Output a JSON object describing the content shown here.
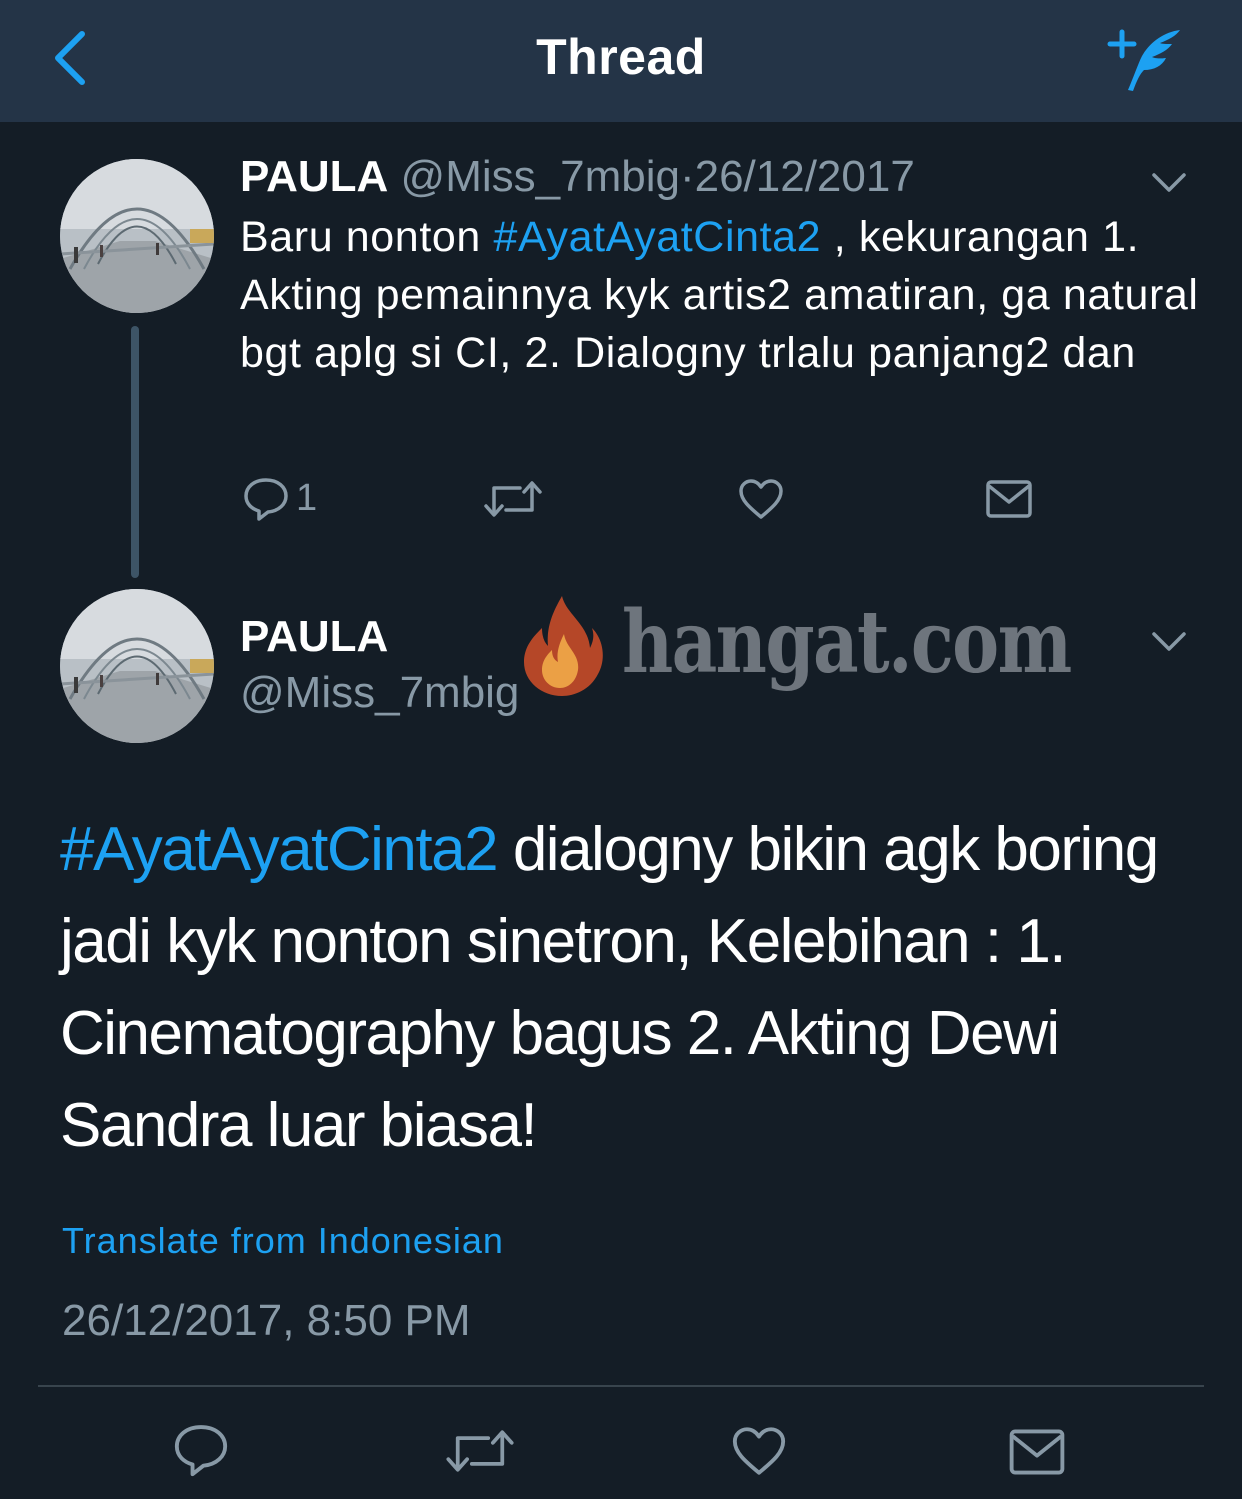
{
  "navbar": {
    "title": "Thread",
    "back_icon": "chevron-left-icon",
    "compose_icon": "compose-tweet-icon"
  },
  "tweet1": {
    "name": "PAULA",
    "handle": "@Miss_7mbig",
    "separator": "·",
    "date": "26/12/2017",
    "text_before": "Baru nonton ",
    "hashtag": "#AyatAyatCinta2",
    "text_after": " , kekurangan 1. Akting pemainnya kyk artis2 amatiran, ga natural bgt aplg si CI, 2. Dialogny trlalu panjang2 dan",
    "reply_count": "1"
  },
  "tweet2": {
    "name": "PAULA",
    "handle": "@Miss_7mbig",
    "hashtag": "#AyatAyatCinta2",
    "text_after": " dialogny bikin agk boring jadi kyk nonton sinetron, Kelebihan : 1. Cinematography bagus 2. Akting Dewi Sandra luar biasa!",
    "translate_label": "Translate from Indonesian",
    "timestamp": "26/12/2017, 8:50 PM"
  },
  "watermark": {
    "text": "hangat.com"
  },
  "colors": {
    "background": "#141d26",
    "navbar": "#243447",
    "accent": "#1da1f2",
    "secondary_text": "#8899a6"
  }
}
